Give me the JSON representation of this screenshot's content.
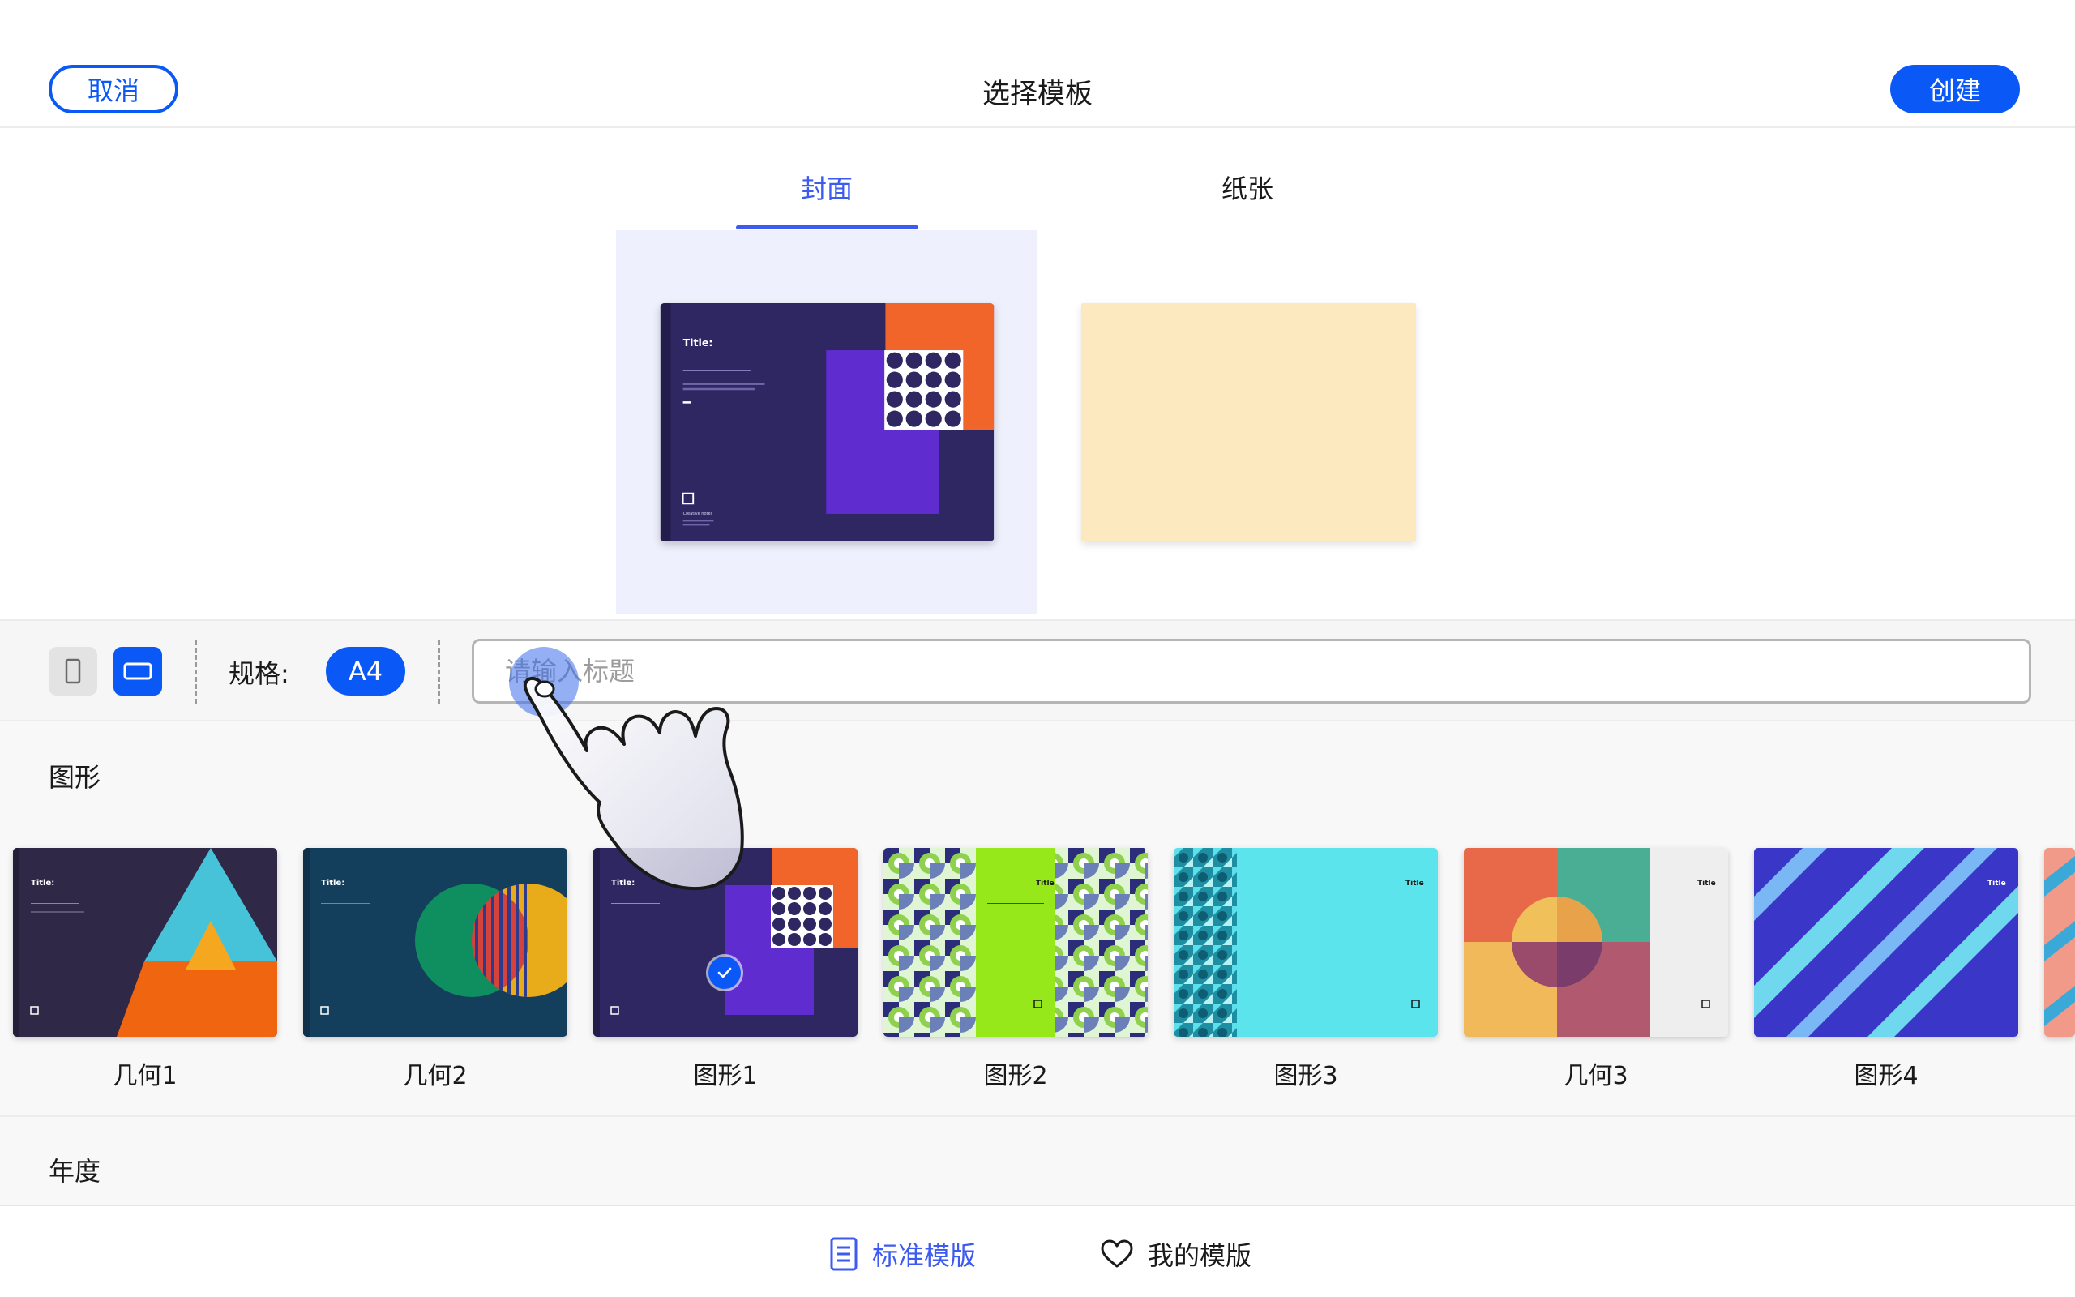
{
  "header": {
    "cancel_label": "取消",
    "title": "选择模板",
    "create_label": "创建"
  },
  "tabs": [
    {
      "label": "封面",
      "active": true
    },
    {
      "label": "纸张",
      "active": false
    }
  ],
  "toolbar": {
    "orientation": "landscape",
    "size_label": "规格:",
    "size_value": "A4",
    "title_input": {
      "value": "",
      "placeholder": "请输入标题"
    }
  },
  "sections": [
    {
      "title": "图形",
      "templates": [
        {
          "label": "几何1",
          "selected": false
        },
        {
          "label": "几何2",
          "selected": false
        },
        {
          "label": "图形1",
          "selected": true
        },
        {
          "label": "图形2",
          "selected": false
        },
        {
          "label": "图形3",
          "selected": false
        },
        {
          "label": "几何3",
          "selected": false
        },
        {
          "label": "图形4",
          "selected": false
        }
      ]
    },
    {
      "title": "年度",
      "templates": []
    }
  ],
  "bottom_tabs": [
    {
      "label": "标准模版",
      "icon": "document-list-icon",
      "active": true
    },
    {
      "label": "我的模版",
      "icon": "heart-icon",
      "active": false
    }
  ],
  "cover_text": {
    "title": "Title:",
    "subtitle": "Creative notes"
  },
  "colors": {
    "accent": "#0a59f7",
    "tab_active": "#3d5af1",
    "cover_navy": "#2e2762",
    "cover_orange": "#f2652a",
    "cover_purple": "#5e2ccf",
    "paper_cream": "#fde9bf"
  }
}
